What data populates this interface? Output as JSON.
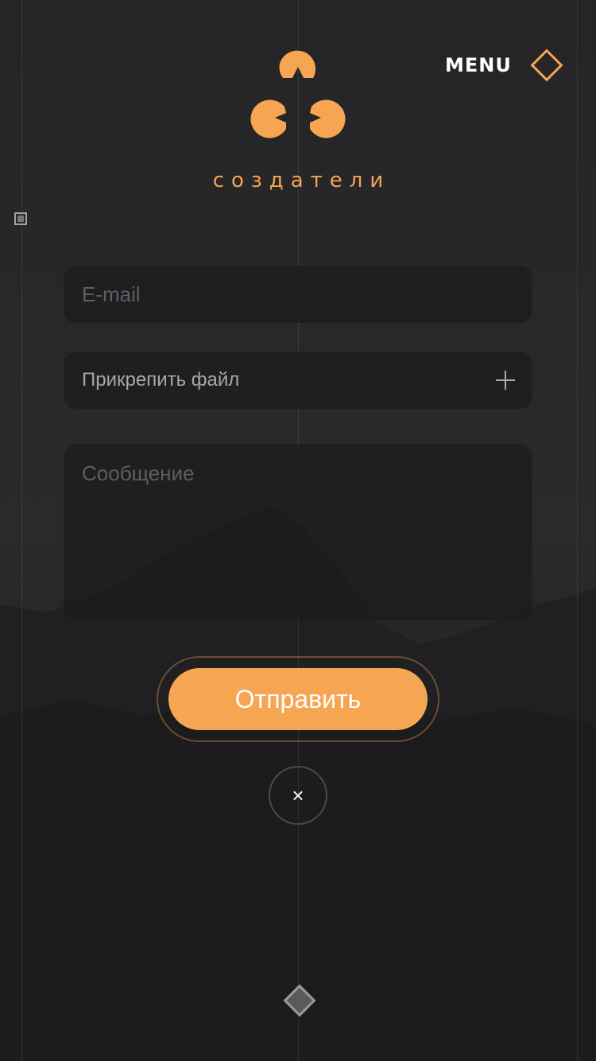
{
  "brand": {
    "name": "создатели"
  },
  "header": {
    "menu_label": "MENU"
  },
  "form": {
    "email_placeholder": "E-mail",
    "attach_label": "Прикрепить файл",
    "message_placeholder": "Сообщение",
    "submit_label": "Отправить",
    "close_symbol": "×"
  },
  "colors": {
    "accent": "#f6a552",
    "background": "#232224",
    "field": "#1c1b1e"
  },
  "icons": [
    "logo-icon",
    "diamond-menu-icon",
    "plus-icon",
    "close-icon",
    "diamond-icon",
    "square-icon"
  ]
}
